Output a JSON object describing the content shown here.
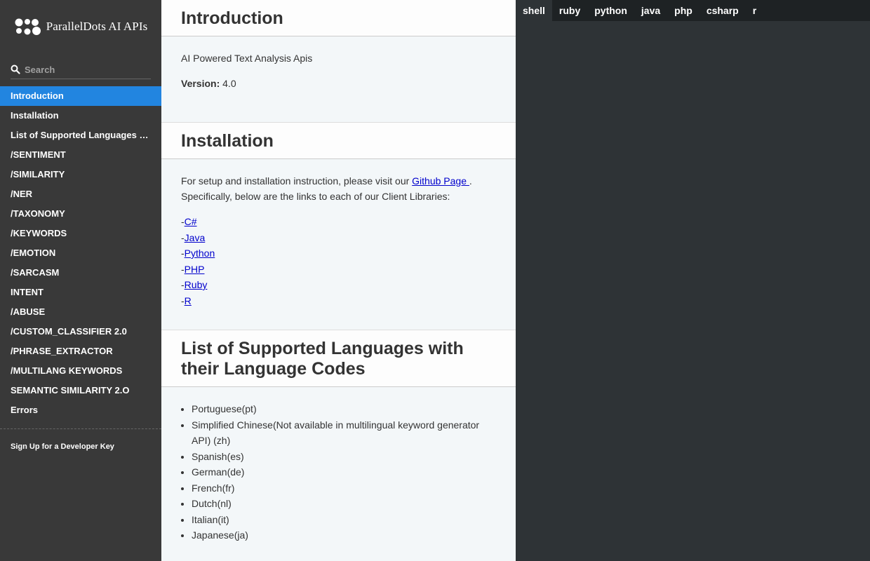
{
  "logo": {
    "text": "ParallelDots AI APIs"
  },
  "search": {
    "placeholder": "Search"
  },
  "toc": [
    "Introduction",
    "Installation",
    "List of Supported Languages with their Language Codes",
    "/SENTIMENT",
    "/SIMILARITY",
    "/NER",
    "/TAXONOMY",
    "/KEYWORDS",
    "/EMOTION",
    "/SARCASM",
    "INTENT",
    "/ABUSE",
    "/CUSTOM_CLASSIFIER 2.0",
    "/PHRASE_EXTRACTOR",
    "/MULTILANG KEYWORDS",
    "SEMANTIC SIMILARITY 2.O",
    "Errors"
  ],
  "toc_footer": "Sign Up for a Developer Key",
  "intro": {
    "title": "Introduction",
    "description": "AI Powered Text Analysis Apis",
    "version_label": "Version:",
    "version_value": "4.0"
  },
  "installation": {
    "title": "Installation",
    "text_before": "For setup and installation instruction, please visit our ",
    "link_text": "Github Page ",
    "text_after": ". Specifically, below are the links to each of our Client Libraries:",
    "libraries": [
      "C#",
      "Java",
      "Python",
      "PHP",
      "Ruby",
      "R"
    ]
  },
  "languages": {
    "title": "List of Supported Languages with their Language Codes",
    "items": [
      "Portuguese(pt)",
      "Simplified Chinese(Not available in multilingual keyword generator API) (zh)",
      "Spanish(es)",
      "German(de)",
      "French(fr)",
      "Dutch(nl)",
      "Italian(it)",
      "Japanese(ja)"
    ]
  },
  "code_tabs": [
    "shell",
    "ruby",
    "python",
    "java",
    "php",
    "csharp",
    "r"
  ],
  "code_tab_active": "shell"
}
